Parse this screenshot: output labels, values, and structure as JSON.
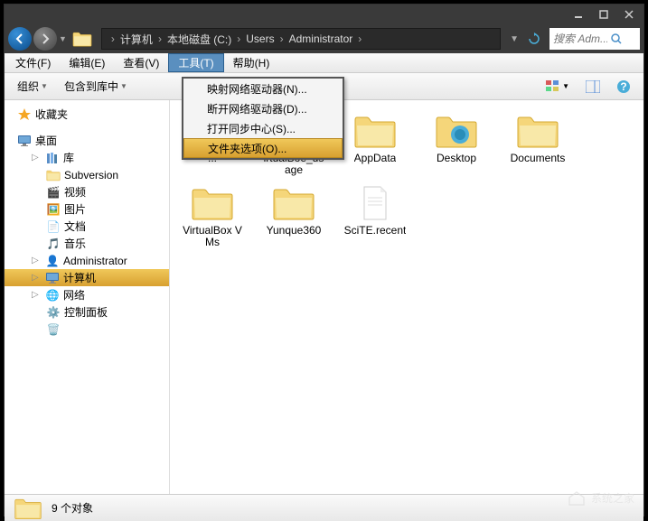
{
  "breadcrumb": [
    "计算机",
    "本地磁盘 (C:)",
    "Users",
    "Administrator"
  ],
  "search": {
    "placeholder": "搜索 Adm..."
  },
  "menubar": {
    "file": "文件(F)",
    "edit": "编辑(E)",
    "view": "查看(V)",
    "tools": "工具(T)",
    "help": "帮助(H)"
  },
  "dropdown": {
    "map_drive": "映射网络驱动器(N)...",
    "disconnect_drive": "断开网络驱动器(D)...",
    "sync_center": "打开同步中心(S)...",
    "folder_options": "文件夹选项(O)..."
  },
  "toolbar": {
    "organize": "组织",
    "include_in_library": "包含到库中"
  },
  "sidebar": {
    "favorites": "收藏夹",
    "desktop": "桌面",
    "libraries": "库",
    "subversion": "Subversion",
    "videos": "视频",
    "pictures": "图片",
    "documents": "文档",
    "music": "音乐",
    "administrator": "Administrator",
    "computer": "计算机",
    "network": "网络",
    "control_panel": "控制面板"
  },
  "files": [
    {
      "name": "...",
      "type": "folder"
    },
    {
      "name": "irtualBoe_usage",
      "type": "folder"
    },
    {
      "name": "AppData",
      "type": "folder"
    },
    {
      "name": "Desktop",
      "type": "folder-special"
    },
    {
      "name": "Documents",
      "type": "folder"
    },
    {
      "name": "VirtualBox VMs",
      "type": "folder"
    },
    {
      "name": "Yunque360",
      "type": "folder"
    },
    {
      "name": "SciTE.recent",
      "type": "file"
    }
  ],
  "statusbar": {
    "count": "9 个对象"
  },
  "watermark": "系统之家"
}
